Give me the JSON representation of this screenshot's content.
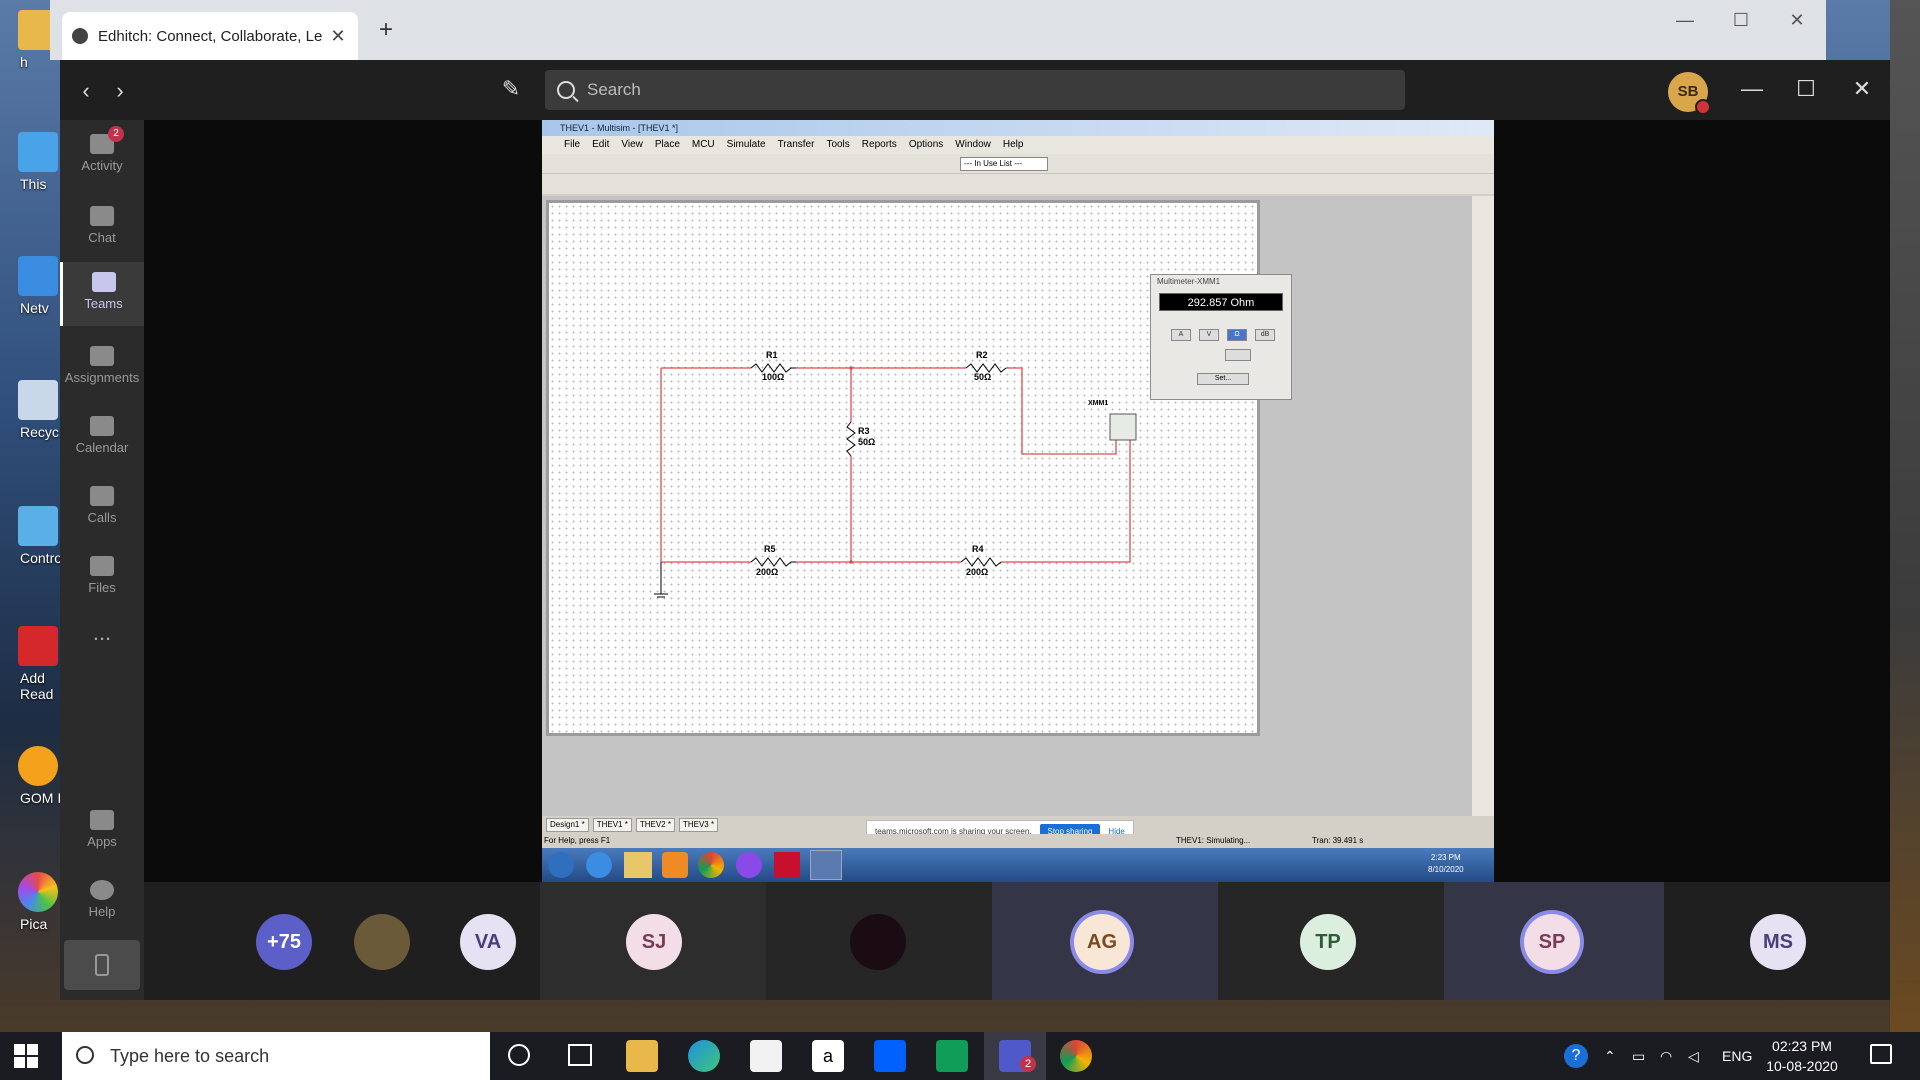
{
  "browser": {
    "tab_title": "Edhitch: Connect, Collaborate, Le",
    "close": "✕",
    "new_tab": "+"
  },
  "desktop_icons": [
    {
      "label": "h"
    },
    {
      "label": "This"
    },
    {
      "label": "Netv"
    },
    {
      "label": "Recyc"
    },
    {
      "label": "Contro"
    },
    {
      "label": "Add\nRead"
    },
    {
      "label": "GOM I"
    },
    {
      "label": "Pica"
    }
  ],
  "teams": {
    "search_placeholder": "Search",
    "user_initials": "SB",
    "activity_badge": "2",
    "rail": [
      {
        "label": "Activity",
        "icon": "bell-icon"
      },
      {
        "label": "Chat",
        "icon": "chat-icon"
      },
      {
        "label": "Teams",
        "icon": "teams-icon"
      },
      {
        "label": "Assignments",
        "icon": "assignments-icon"
      },
      {
        "label": "Calendar",
        "icon": "calendar-icon"
      },
      {
        "label": "Calls",
        "icon": "phone-icon"
      },
      {
        "label": "Files",
        "icon": "files-icon"
      },
      {
        "label": "...",
        "icon": "more-icon"
      },
      {
        "label": "Apps",
        "icon": "apps-icon"
      },
      {
        "label": "Help",
        "icon": "help-icon"
      }
    ],
    "participants": [
      {
        "initials": "+75",
        "color": "#5b5fc7",
        "text": "#ffffff"
      },
      {
        "initials": "",
        "color": "#6b5a3a",
        "text": "#ffffff"
      },
      {
        "initials": "VA",
        "color": "#e6e1f3",
        "text": "#4a3f7a"
      },
      {
        "initials": "SJ",
        "color": "#f3dde6",
        "text": "#7a3b55"
      },
      {
        "initials": "",
        "color": "#1a0c12",
        "text": "#ffffff"
      },
      {
        "initials": "AG",
        "color": "#f8e7d6",
        "text": "#7a4a1f"
      },
      {
        "initials": "TP",
        "color": "#dcefdf",
        "text": "#2f5b36"
      },
      {
        "initials": "SP",
        "color": "#f3dde6",
        "text": "#7a3b55"
      },
      {
        "initials": "MS",
        "color": "#e6e1f3",
        "text": "#4a3f7a"
      }
    ]
  },
  "multisim": {
    "title": "THEV1 - Multisim - [THEV1 *]",
    "menu": [
      "File",
      "Edit",
      "View",
      "Place",
      "MCU",
      "Simulate",
      "Transfer",
      "Tools",
      "Reports",
      "Options",
      "Window",
      "Help"
    ],
    "in_use_list": "--- In Use List ---",
    "components": [
      {
        "ref": "R1",
        "value": "100Ω"
      },
      {
        "ref": "R2",
        "value": "50Ω"
      },
      {
        "ref": "R3",
        "value": "50Ω"
      },
      {
        "ref": "R4",
        "value": "200Ω"
      },
      {
        "ref": "R5",
        "value": "200Ω"
      }
    ],
    "instrument_ref": "XMM1",
    "multimeter": {
      "title": "Multimeter-XMM1",
      "reading": "292.857 Ohm",
      "buttons": [
        "A",
        "V",
        "Ω",
        "dB"
      ],
      "set_label": "Set..."
    },
    "sheet_tabs": [
      "Design1 *",
      "THEV1 *",
      "THEV2 *",
      "THEV3 *"
    ],
    "status_left": "For Help, press F1",
    "status_mid": "THEV1: Simulating...",
    "status_right": "Tran: 39.491 s",
    "share_text": "teams.microsoft.com is sharing your screen.",
    "stop_sharing": "Stop sharing",
    "hide": "Hide",
    "remote_clock_time": "2:23 PM",
    "remote_clock_date": "8/10/2020"
  },
  "taskbar": {
    "search_placeholder": "Type here to search",
    "teams_badge": "2",
    "lang": "ENG",
    "time": "02:23 PM",
    "date": "10-08-2020"
  }
}
